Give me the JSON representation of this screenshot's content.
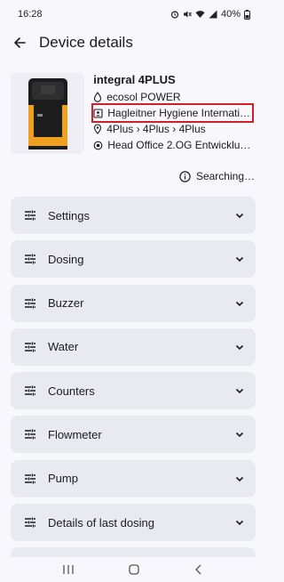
{
  "status_bar": {
    "time": "16:28",
    "battery": "40%"
  },
  "header": {
    "title": "Device details"
  },
  "device": {
    "name": "integral 4PLUS",
    "product": "ecosol POWER",
    "owner": "Hagleitner Hygiene Internati…",
    "path": "4Plus › 4Plus › 4Plus",
    "location": "Head Office 2.OG Entwicklu…"
  },
  "search_status": "Searching…",
  "sections": [
    {
      "label": "Settings"
    },
    {
      "label": "Dosing"
    },
    {
      "label": "Buzzer"
    },
    {
      "label": "Water"
    },
    {
      "label": "Counters"
    },
    {
      "label": "Flowmeter"
    },
    {
      "label": "Pump"
    },
    {
      "label": "Details of last dosing"
    }
  ],
  "colors": {
    "highlight": "#d0202a",
    "accent_device": "#f0a020",
    "card_bg": "#e9e9f1"
  }
}
